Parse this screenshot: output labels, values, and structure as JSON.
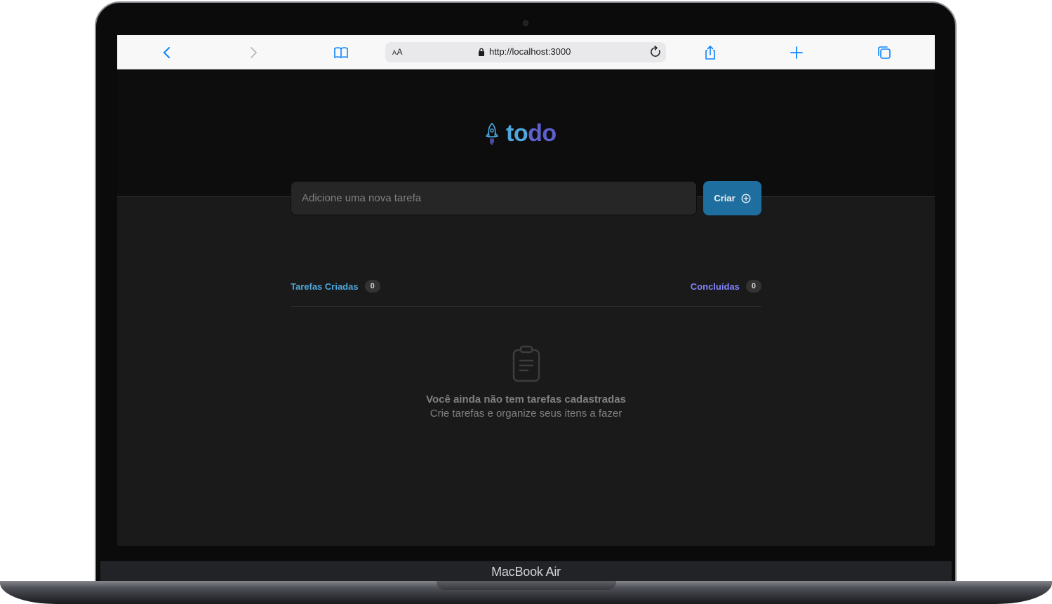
{
  "device": {
    "label": "MacBook Air"
  },
  "browser": {
    "text_size_label_big": "A",
    "text_size_label_small": "A",
    "url": "http://localhost:3000",
    "accent_color": "#0a84ff",
    "icons": [
      "back-icon",
      "forward-icon",
      "bookmarks-icon",
      "lock-icon",
      "reload-icon",
      "share-icon",
      "new-tab-icon",
      "tabs-icon"
    ]
  },
  "app": {
    "logo_part1": "to",
    "logo_part2": "do",
    "colors": {
      "blue": "#4ea8de",
      "purple": "#5e60ce",
      "button": "#1e6f9f",
      "purple_light": "#8284fa"
    },
    "new_task": {
      "placeholder": "Adicione uma nova tarefa",
      "value": "",
      "button_label": "Criar"
    },
    "counters": {
      "created_label": "Tarefas Criadas",
      "created_count": "0",
      "done_label": "Concluídas",
      "done_count": "0"
    },
    "empty_state": {
      "title": "Você ainda não tem tarefas cadastradas",
      "subtitle": "Crie tarefas e organize seus itens a fazer"
    }
  }
}
